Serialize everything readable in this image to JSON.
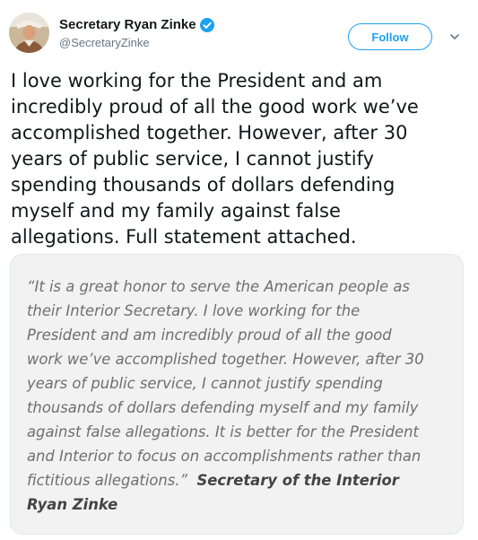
{
  "user": {
    "display_name": "Secretary Ryan Zinke",
    "handle": "@SecretaryZinke",
    "verified": true,
    "avatar_icon": "profile-photo"
  },
  "actions": {
    "follow_label": "Follow",
    "more_icon": "chevron-down-icon"
  },
  "tweet": {
    "lines": [
      "I love working for the President and am",
      "incredibly proud of all the good work we’ve",
      "accomplished together. However, after 30",
      "years of public service, I cannot justify",
      "spending thousands of dollars defending",
      "myself and my family against false",
      "allegations. Full statement attached."
    ]
  },
  "statement_image": {
    "lines": [
      "“It is a great honor to serve the American people as",
      "their Interior Secretary. I love working for the",
      "President and am incredibly proud of all the good",
      "work we’ve accomplished together. However, after 30",
      "years of public service, I cannot justify spending",
      "thousands of dollars defending myself and my family",
      "against false allegations. It is better for the President",
      "and Interior to focus on accomplishments rather than",
      "fictitious allegations.”"
    ],
    "signature_line1": "Secretary of the Interior",
    "signature_line2": "Ryan Zinke"
  },
  "colors": {
    "accent": "#1da1f2",
    "handle": "#657786",
    "card_background": "#f2f2f2"
  }
}
